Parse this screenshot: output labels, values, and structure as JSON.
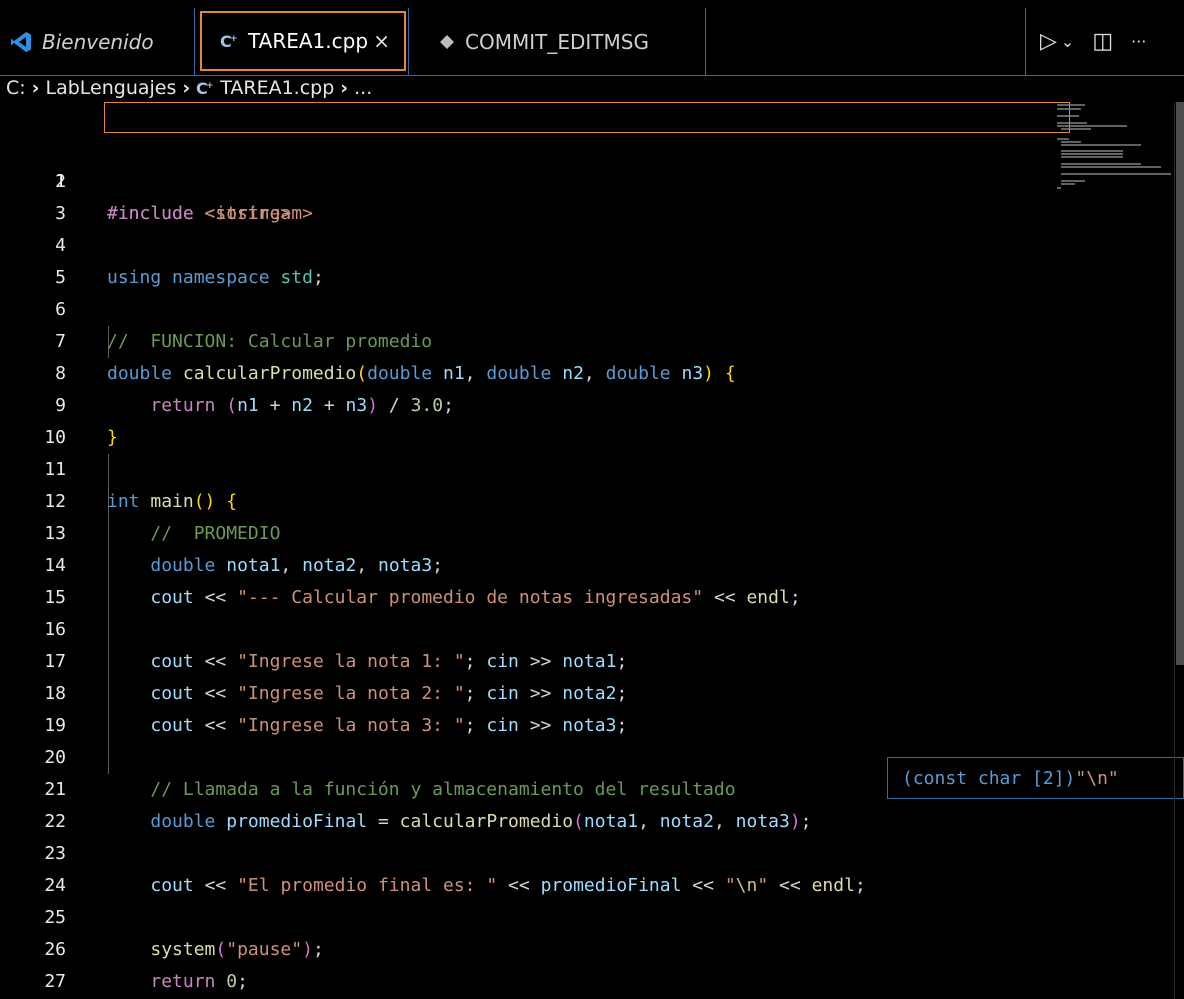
{
  "tabs": [
    {
      "label": "Bienvenido",
      "icon": "vscode-logo-icon"
    },
    {
      "label": "TAREA1.cpp",
      "icon": "cpp-file-icon",
      "close": "×"
    },
    {
      "label": "COMMIT_EDITMSG",
      "icon": "git-commit-icon"
    }
  ],
  "toolbar": {
    "run": "▷",
    "run_dropdown": "⌄",
    "split": "◫",
    "more": "···"
  },
  "breadcrumb": {
    "drive": "C:",
    "folder": "LabLenguajes",
    "file": "TAREA1.cpp",
    "more": "..."
  },
  "line_numbers": [
    "1",
    "2",
    "3",
    "4",
    "5",
    "6",
    "7",
    "8",
    "9",
    "10",
    "11",
    "12",
    "13",
    "14",
    "15",
    "16",
    "17",
    "18",
    "19",
    "20",
    "21",
    "22",
    "23",
    "24",
    "25",
    "26",
    "27"
  ],
  "hover_tooltip": {
    "cast": "(const char [2])",
    "value": "\"\\n\""
  },
  "colors": {
    "accent": "#e08a2f",
    "border": "#2b6ea5",
    "background": "#000000"
  }
}
